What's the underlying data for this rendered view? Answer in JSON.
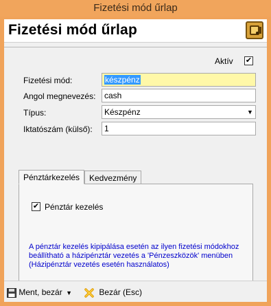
{
  "window": {
    "title": "Fizetési mód űrlap"
  },
  "header": {
    "title": "Fizetési mód űrlap",
    "icon": "safe-icon"
  },
  "form": {
    "active": {
      "label": "Aktív",
      "checked": true,
      "mark": "✔"
    },
    "payment_method": {
      "label": "Fizetési mód:",
      "value": "készpénz"
    },
    "english_name": {
      "label": "Angol megnevezés:",
      "value": "cash"
    },
    "type": {
      "label": "Típus:",
      "value": "Készpénz"
    },
    "iktato": {
      "label": "Iktatószám (külső):",
      "value": "1"
    }
  },
  "tabs": {
    "items": [
      {
        "label": "Pénztárkezelés",
        "active": true
      },
      {
        "label": "Kedvezmény",
        "active": false
      }
    ],
    "cash_register": {
      "label": "Pénztár kezelés",
      "checked": true,
      "mark": "✔"
    },
    "info_text": "A pénztár kezelés kipipálása esetén az ilyen fizetési módokhoz beállítható a házipénztár vezetés a 'Pénzeszközök' menüben (Házipénztár vezetés esetén használatos)"
  },
  "toolbar": {
    "save_close": "Ment, bezár",
    "close": "Bezár (Esc)"
  },
  "colors": {
    "titlebar": "#f1a55c",
    "required_field": "#fff8a8",
    "selection": "#3399ff",
    "info_text": "#0000cc"
  }
}
